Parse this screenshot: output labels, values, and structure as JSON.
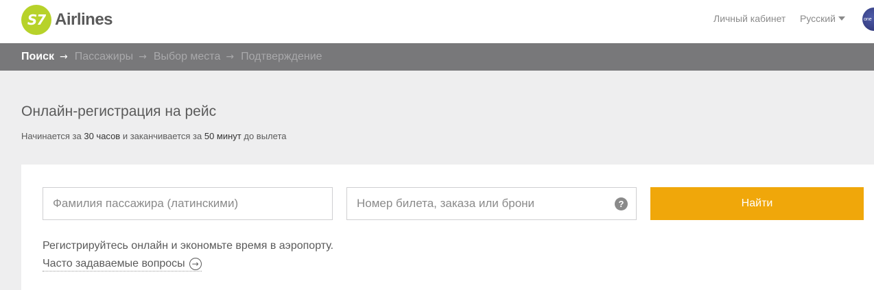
{
  "header": {
    "logo_mark": "S7",
    "logo_text": "Airlines",
    "account_link": "Личный кабинет",
    "language": "Русский",
    "alliance_badge": "one"
  },
  "steps": [
    {
      "label": "Поиск",
      "active": true
    },
    {
      "label": "Пассажиры",
      "active": false
    },
    {
      "label": "Выбор места",
      "active": false
    },
    {
      "label": "Подтверждение",
      "active": false
    }
  ],
  "intro": {
    "title": "Онлайн-регистрация на рейс",
    "subtitle_prefix": "Начинается за ",
    "subtitle_start": "30 часов",
    "subtitle_mid": " и заканчивается за ",
    "subtitle_end": "50 минут",
    "subtitle_suffix": " до вылета"
  },
  "form": {
    "surname_placeholder": "Фамилия пассажира (латинскими)",
    "ticket_placeholder": "Номер билета, заказа или брони",
    "help_symbol": "?",
    "submit_label": "Найти",
    "note": "Регистрируйтесь онлайн и экономьте время в аэропорту.",
    "faq_link": "Часто задаваемые вопросы",
    "faq_icon": "→"
  },
  "colors": {
    "brand_green": "#b7d22a",
    "accent_orange": "#f0a70a",
    "steps_bar": "#78787a"
  }
}
